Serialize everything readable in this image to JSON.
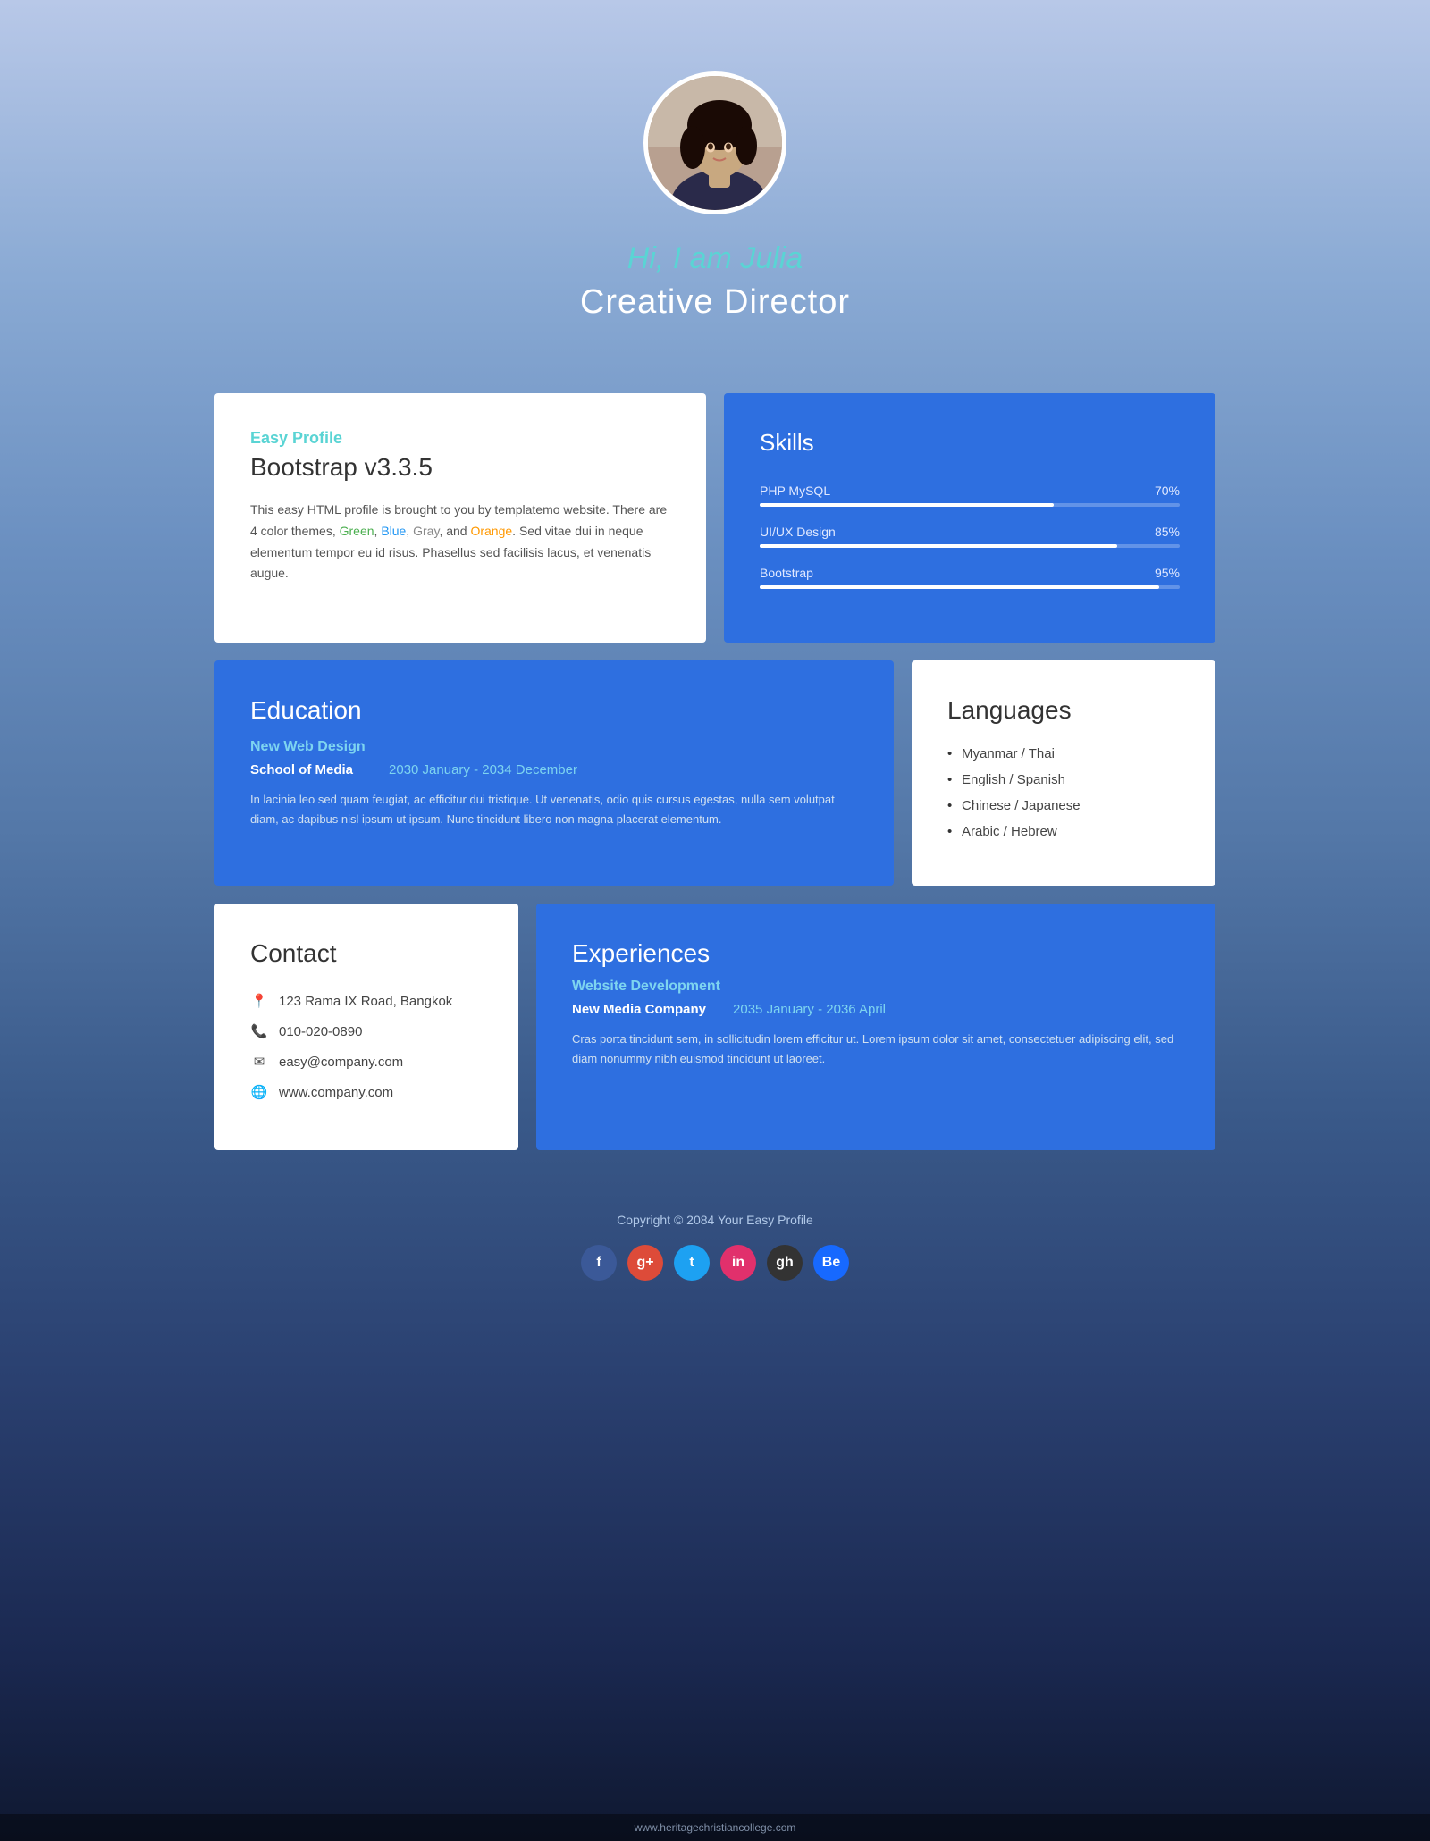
{
  "hero": {
    "greeting": "Hi, I am Julia",
    "title": "Creative Director"
  },
  "profile_card": {
    "label": "Easy Profile",
    "subtitle": "Bootstrap v3.3.5",
    "text": "This easy HTML profile is brought to you by templatemo website. There are 4 color themes,",
    "color_words": [
      "Green",
      "Blue",
      "Gray",
      "and",
      "Orange"
    ],
    "text2": ". Sed vitae dui in neque elementum tempor eu id risus. Phasellus sed facilisis lacus, et venenatis augue."
  },
  "skills": {
    "title": "Skills",
    "items": [
      {
        "name": "PHP MySQL",
        "percent": 70,
        "label": "70%"
      },
      {
        "name": "UI/UX Design",
        "percent": 85,
        "label": "85%"
      },
      {
        "name": "Bootstrap",
        "percent": 95,
        "label": "95%"
      }
    ]
  },
  "education": {
    "title": "Education",
    "school_label": "New Web Design",
    "school_name": "School of Media",
    "date": "2030 January - 2034 December",
    "description": "In lacinia leo sed quam feugiat, ac efficitur dui tristique. Ut venenatis, odio quis cursus egestas, nulla sem volutpat diam, ac dapibus nisl ipsum ut ipsum. Nunc tincidunt libero non magna placerat elementum."
  },
  "languages": {
    "title": "Languages",
    "items": [
      "Myanmar / Thai",
      "English / Spanish",
      "Chinese / Japanese",
      "Arabic / Hebrew"
    ]
  },
  "contact": {
    "title": "Contact",
    "address": "123 Rama IX Road, Bangkok",
    "phone": "010-020-0890",
    "email": "easy@company.com",
    "website": "www.company.com"
  },
  "experiences": {
    "title": "Experiences",
    "role_label": "Website Development",
    "company": "New Media Company",
    "date": "2035 January - 2036 April",
    "description": "Cras porta tincidunt sem, in sollicitudin lorem efficitur ut. Lorem ipsum dolor sit amet, consectetuer adipiscing elit, sed diam nonummy nibh euismod tincidunt ut laoreet."
  },
  "footer": {
    "copyright": "Copyright © 2084 Your Easy Profile"
  },
  "bottom_bar": {
    "url": "www.heritagechristiancollege.com"
  },
  "social": [
    {
      "name": "facebook",
      "letter": "f",
      "class": "social-fb"
    },
    {
      "name": "google-plus",
      "letter": "g+",
      "class": "social-gp"
    },
    {
      "name": "twitter",
      "letter": "t",
      "class": "social-tw"
    },
    {
      "name": "instagram",
      "letter": "in",
      "class": "social-in"
    },
    {
      "name": "github",
      "letter": "gh",
      "class": "social-gh"
    },
    {
      "name": "behance",
      "letter": "Be",
      "class": "social-be"
    }
  ],
  "colors": {
    "accent_teal": "#5ad4d4",
    "accent_blue": "#2e6fe0",
    "white": "#ffffff"
  }
}
